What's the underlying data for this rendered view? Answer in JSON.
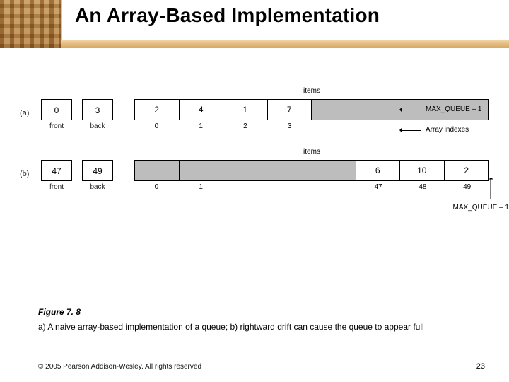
{
  "title": "An Array-Based Implementation",
  "labels": {
    "items": "items",
    "front": "front",
    "back": "back",
    "arrayIndexes": "Array indexes",
    "maxQueue": "MAX_QUEUE – 1"
  },
  "rowA": {
    "tag": "(a)",
    "front": "0",
    "back": "3",
    "cells": [
      "2",
      "4",
      "1",
      "7",
      "",
      "",
      "",
      ""
    ],
    "empty": [
      false,
      false,
      false,
      false,
      true,
      true,
      true,
      true
    ],
    "noborder": [
      false,
      false,
      false,
      false,
      true,
      true,
      true,
      false
    ],
    "idx": [
      "0",
      "1",
      "2",
      "3",
      "",
      "",
      "",
      ""
    ]
  },
  "rowB": {
    "tag": "(b)",
    "front": "47",
    "back": "49",
    "cells": [
      "",
      "",
      "",
      "",
      "",
      "6",
      "10",
      "2"
    ],
    "empty": [
      true,
      true,
      true,
      true,
      true,
      false,
      false,
      false
    ],
    "noborder": [
      false,
      false,
      true,
      true,
      true,
      false,
      false,
      false
    ],
    "idx": [
      "0",
      "1",
      "",
      "",
      "",
      "47",
      "48",
      "49"
    ]
  },
  "caption": {
    "num": "Figure 7. 8",
    "text": "a) A naive array-based implementation of a queue; b) rightward drift can cause the queue to appear full"
  },
  "footer": "© 2005 Pearson Addison-Wesley. All rights reserved",
  "page": "23",
  "chart_data": [
    {
      "type": "table",
      "title": "Naive array-based queue state (a)",
      "front": 0,
      "back": 3,
      "indexes": [
        0,
        1,
        2,
        3
      ],
      "values": [
        2,
        4,
        1,
        7
      ],
      "capacity_hint": "MAX_QUEUE – 1"
    },
    {
      "type": "table",
      "title": "Rightward-drift queue state (b)",
      "front": 47,
      "back": 49,
      "indexes": [
        47,
        48,
        49
      ],
      "values": [
        6,
        10,
        2
      ],
      "capacity_hint": "MAX_QUEUE – 1"
    }
  ]
}
